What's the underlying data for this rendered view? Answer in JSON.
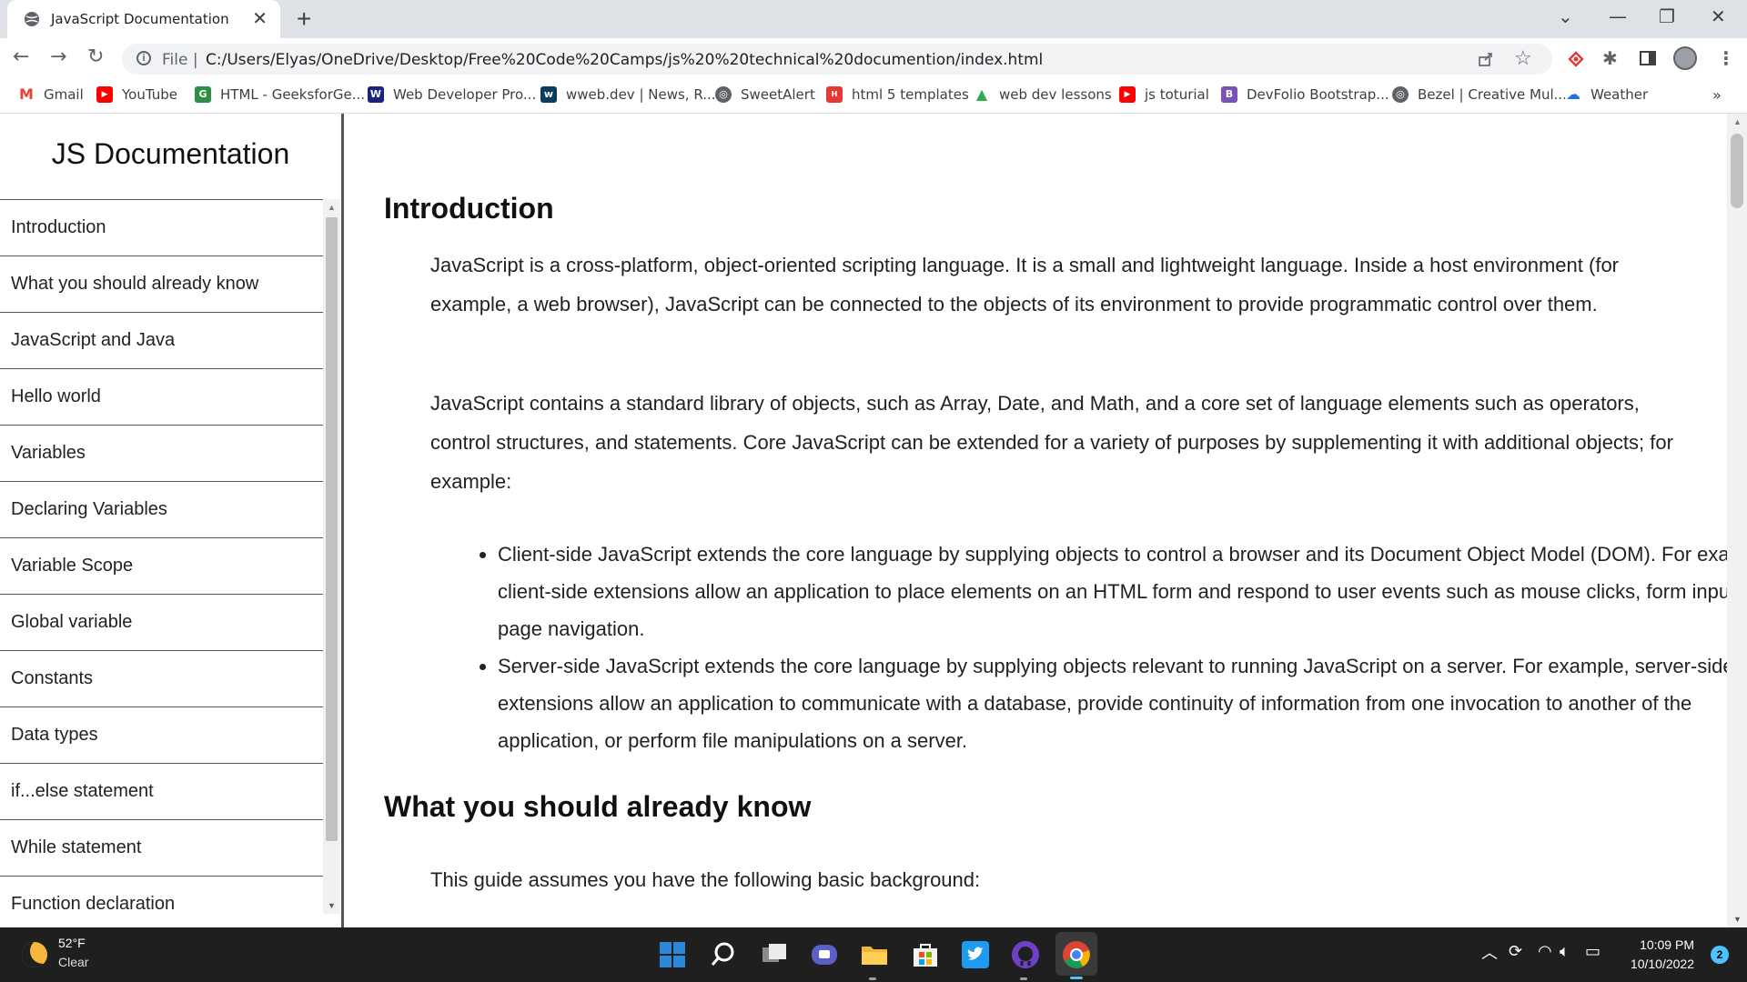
{
  "browser": {
    "tab_title": "JavaScript Documentation",
    "close_glyph": "✕",
    "new_tab_glyph": "+",
    "window_controls": [
      "⌄",
      "—",
      "❐",
      "✕"
    ],
    "nav": {
      "back": "←",
      "forward": "→",
      "reload": "↻"
    },
    "address": {
      "scheme": "File  |",
      "url": "C:/Users/Elyas/OneDrive/Desktop/Free%20Code%20Camps/js%20%20technical%20documention/index.html"
    },
    "toolbar_icons": [
      "share-icon",
      "star-icon",
      "extension-icon",
      "puzzle-icon",
      "sidepanel-icon",
      "profile-icon",
      "menu-icon"
    ],
    "bookmarks": [
      {
        "label": "Gmail",
        "icon": "gmail-icon",
        "color": "#ea4335",
        "glyph": "M"
      },
      {
        "label": "YouTube",
        "icon": "youtube-icon",
        "color": "#ff0000",
        "glyph": "▶"
      },
      {
        "label": "HTML - GeeksforGe...",
        "icon": "geeksforgeeks-icon",
        "color": "#2f8d46",
        "glyph": "G"
      },
      {
        "label": "Web Developer Pro...",
        "icon": "webdev-icon",
        "color": "#1a237e",
        "glyph": "W"
      },
      {
        "label": "wweb.dev | News, R...",
        "icon": "wwebdev-icon",
        "color": "#0b3d5c",
        "glyph": "w"
      },
      {
        "label": "SweetAlert",
        "icon": "globe-icon",
        "color": "#5f6368",
        "glyph": "◎"
      },
      {
        "label": "html 5 templates",
        "icon": "html5up-icon",
        "color": "#e53935",
        "glyph": "H"
      },
      {
        "label": "web dev lessons",
        "icon": "drive-icon",
        "color": "#34a853",
        "glyph": "▲"
      },
      {
        "label": "js toturial",
        "icon": "youtube-icon",
        "color": "#ff0000",
        "glyph": "▶"
      },
      {
        "label": "DevFolio Bootstrap...",
        "icon": "bootstrap-icon",
        "color": "#7952b3",
        "glyph": "B"
      },
      {
        "label": "Bezel | Creative Mul...",
        "icon": "globe-icon",
        "color": "#5f6368",
        "glyph": "◎"
      },
      {
        "label": "Weather",
        "icon": "weather-icon",
        "color": "#1a73e8",
        "glyph": "☁"
      }
    ],
    "bookmarks_overflow": "»"
  },
  "page": {
    "brand": "JS Documentation",
    "nav_links": [
      "Introduction",
      "What you should already know",
      "JavaScript and Java",
      "Hello world",
      "Variables",
      "Declaring Variables",
      "Variable Scope",
      "Global variable",
      "Constants",
      "Data types",
      "if...else statement",
      "While statement",
      "Function declaration"
    ],
    "sections": {
      "intro_heading": "Introduction",
      "intro_p1": "JavaScript is a cross-platform, object-oriented scripting language. It is a small and lightweight language. Inside a host environment (for example, a web browser), JavaScript can be connected to the objects of its environment to provide programmatic control over them.",
      "intro_p2": "JavaScript contains a standard library of objects, such as Array, Date, and Math, and a core set of language elements such as operators, control structures, and statements. Core JavaScript can be extended for a variety of purposes by supplementing it with additional objects; for example:",
      "intro_bullets": [
        "Client-side JavaScript extends the core language by supplying objects to control a browser and its Document Object Model (DOM). For example, client-side extensions allow an application to place elements on an HTML form and respond to user events such as mouse clicks, form input, and page navigation.",
        "Server-side JavaScript extends the core language by supplying objects relevant to running JavaScript on a server. For example, server-side extensions allow an application to communicate with a database, provide continuity of information from one invocation to another of the application, or perform file manipulations on a server."
      ],
      "know_heading": "What you should already know",
      "know_p1": "This guide assumes you have the following basic background:"
    }
  },
  "taskbar": {
    "weather_temp": "52°F",
    "weather_cond": "Clear",
    "apps": [
      {
        "name": "start-icon",
        "color": "#0078d4"
      },
      {
        "name": "search-icon",
        "color": "#1f1f1f"
      },
      {
        "name": "task-view-icon",
        "color": "#1f1f1f"
      },
      {
        "name": "teams-chat-icon",
        "color": "#5b5fc7"
      },
      {
        "name": "file-explorer-icon",
        "color": "#f3b53b"
      },
      {
        "name": "microsoft-store-icon",
        "color": "#f3f3f3"
      },
      {
        "name": "twitter-icon",
        "color": "#1d9bf0"
      },
      {
        "name": "github-icon",
        "color": "#6e40c9"
      },
      {
        "name": "chrome-icon",
        "color": "#db4437"
      }
    ],
    "time": "10:09 PM",
    "date": "10/10/2022",
    "notifications": "2"
  }
}
